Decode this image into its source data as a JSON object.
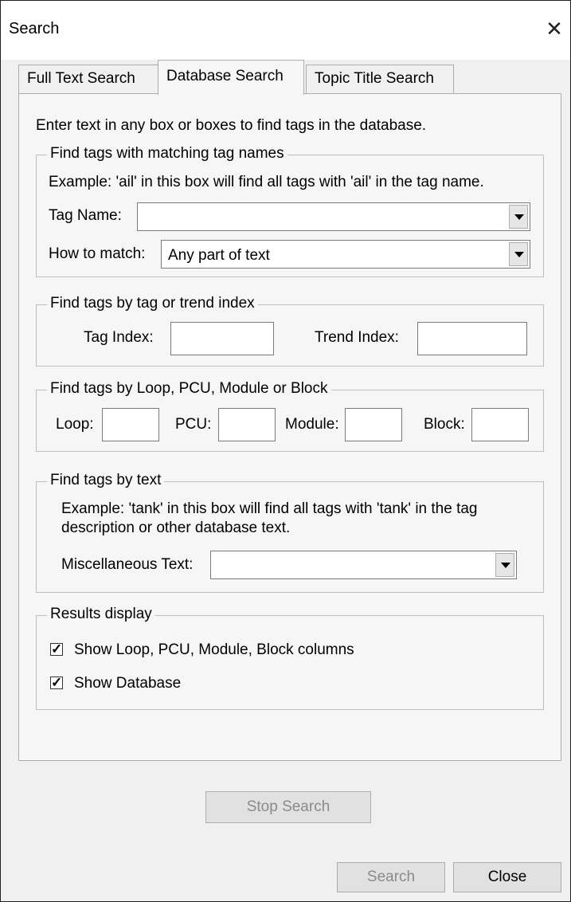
{
  "window": {
    "title": "Search"
  },
  "tabs": [
    {
      "label": "Full Text Search"
    },
    {
      "label": "Database Search",
      "active": true
    },
    {
      "label": "Topic Title Search"
    }
  ],
  "intro": "Enter text in any box or boxes to find tags in the database.",
  "tag_names": {
    "legend": "Find tags with matching tag names",
    "example": "Example:  'ail' in this box will find all tags with 'ail' in the tag name.",
    "tag_name_label": "Tag Name:",
    "tag_name_value": "",
    "how_label": "How to match:",
    "how_value": "Any part of text"
  },
  "index": {
    "legend": "Find tags by tag or trend index",
    "tag_index_label": "Tag Index:",
    "trend_index_label": "Trend Index:"
  },
  "loop": {
    "legend": "Find tags by Loop, PCU, Module or Block",
    "loop_label": "Loop:",
    "pcu_label": "PCU:",
    "module_label": "Module:",
    "block_label": "Block:"
  },
  "text": {
    "legend": "Find tags by text",
    "example_line1": "Example:  'tank' in this box will find all tags with 'tank' in the tag",
    "example_line2": "description or other database text.",
    "misc_label": "Miscellaneous Text:"
  },
  "results": {
    "legend": "Results display",
    "show_columns": "Show Loop, PCU, Module, Block columns",
    "show_columns_checked": true,
    "show_database": "Show Database",
    "show_database_checked": true
  },
  "buttons": {
    "stop_search": "Stop Search",
    "search": "Search",
    "close": "Close"
  }
}
